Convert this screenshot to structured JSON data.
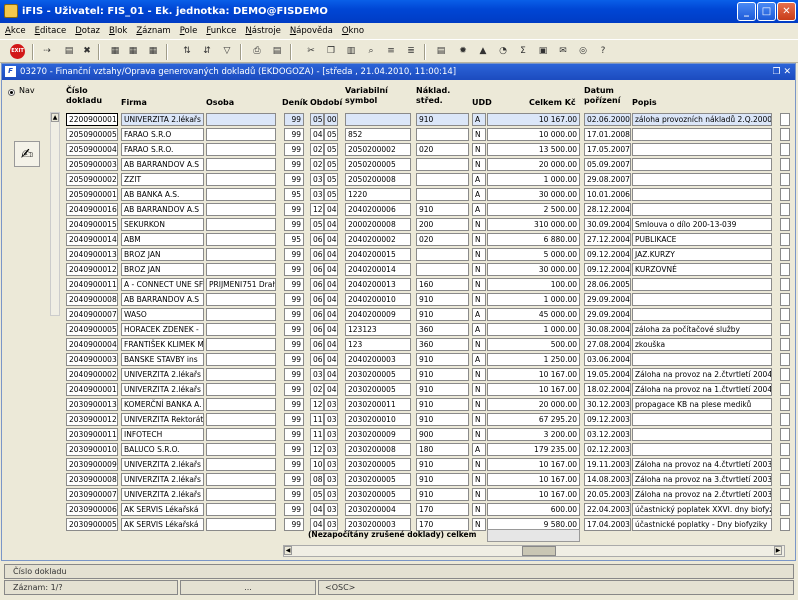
{
  "app": {
    "title": "iFIS - Uživatel: FIS_01 - Ek. jednotka: DEMO@FISDEMO"
  },
  "menu": [
    "Akce",
    "Editace",
    "Dotaz",
    "Blok",
    "Záznam",
    "Pole",
    "Funkce",
    "Nástroje",
    "Nápověda",
    "Okno"
  ],
  "toolbar": {
    "exit_label": "EXIT"
  },
  "window": {
    "title": "03270 - Finanční vztahy/Oprava generovaných dokladů (EKDOGOZA) - [středa , 21.04.2010, 11:00:14]"
  },
  "nav": {
    "label": "Nav"
  },
  "columns": {
    "cislo": "Číslo\ndokladu",
    "firma": "Firma",
    "osoba": "Osoba",
    "denik": "Deník",
    "obdobi": "Období",
    "vs": "Variabilní\nsymbol",
    "ns": "Náklad.\nstřed.",
    "udd": "UDD",
    "celkem": "Celkem Kč",
    "datum": "Datum\npořízení",
    "popis": "Popis"
  },
  "rows": [
    [
      "2200900001",
      "UNIVERZITA 2.lékařs",
      "",
      "99",
      "05",
      "00",
      "",
      "910",
      "A",
      "10 167.00",
      "02.06.2000",
      "záloha provozních nákladů 2.Q.2000"
    ],
    [
      "2050900005",
      "FARAO S.R.O",
      "",
      "99",
      "04",
      "05",
      "852",
      "",
      "N",
      "10 000.00",
      "17.01.2008",
      ""
    ],
    [
      "2050900004",
      "FARAO S.R.O.",
      "",
      "99",
      "02",
      "05",
      "2050200002",
      "020",
      "N",
      "13 500.00",
      "17.05.2007",
      ""
    ],
    [
      "2050900003",
      "AB BARRANDOV A.S",
      "",
      "99",
      "02",
      "05",
      "2050200005",
      "",
      "N",
      "20 000.00",
      "05.09.2007",
      ""
    ],
    [
      "2050900002",
      "ZZIT",
      "",
      "99",
      "03",
      "05",
      "2050200008",
      "",
      "A",
      "1 000.00",
      "29.08.2007",
      ""
    ],
    [
      "2050900001",
      "AB BANKA A.S.",
      "",
      "95",
      "03",
      "05",
      "1220",
      "",
      "A",
      "30 000.00",
      "10.01.2006",
      ""
    ],
    [
      "2040900016",
      "AB BARRANDOV A.S",
      "",
      "99",
      "12",
      "04",
      "2040200006",
      "910",
      "A",
      "2 500.00",
      "28.12.2004",
      ""
    ],
    [
      "2040900015",
      "SEKURKON",
      "",
      "99",
      "05",
      "04",
      "2000200008",
      "200",
      "N",
      "310 000.00",
      "30.09.2004",
      "Smlouva o dílo 200-13-039"
    ],
    [
      "2040900014",
      "ABM",
      "",
      "95",
      "06",
      "04",
      "2040200002",
      "020",
      "N",
      "6 880.00",
      "27.12.2004",
      "PUBLIKACE"
    ],
    [
      "2040900013",
      "BROZ JAN",
      "",
      "99",
      "06",
      "04",
      "2040200015",
      "",
      "N",
      "5 000.00",
      "09.12.2004",
      "JAZ.KURZY"
    ],
    [
      "2040900012",
      "BROZ JAN",
      "",
      "99",
      "06",
      "04",
      "2040200014",
      "",
      "N",
      "30 000.00",
      "09.12.2004",
      "KURZOVNÉ"
    ],
    [
      "2040900011",
      "A - CONNECT UNE SF",
      "PRIJMENI751 Drah",
      "99",
      "06",
      "04",
      "2040200013",
      "160",
      "N",
      "100.00",
      "28.06.2005",
      ""
    ],
    [
      "2040900008",
      "AB BARRANDOV A.S",
      "",
      "99",
      "06",
      "04",
      "2040200010",
      "910",
      "N",
      "1 000.00",
      "29.09.2004",
      ""
    ],
    [
      "2040900007",
      "WASO",
      "",
      "99",
      "06",
      "04",
      "2040200009",
      "910",
      "A",
      "45 000.00",
      "29.09.2004",
      ""
    ],
    [
      "2040900005",
      "HORACEK ZDENEK -",
      "",
      "99",
      "06",
      "04",
      "123123",
      "360",
      "A",
      "1 000.00",
      "30.08.2004",
      "záloha za počítačové služby"
    ],
    [
      "2040900004",
      "FRANTIŠEK KLIMEK M",
      "",
      "99",
      "06",
      "04",
      "123",
      "360",
      "N",
      "500.00",
      "27.08.2004",
      "zkouška"
    ],
    [
      "2040900003",
      "BANSKE STAVBY ins",
      "",
      "99",
      "06",
      "04",
      "2040200003",
      "910",
      "A",
      "1 250.00",
      "03.06.2004",
      ""
    ],
    [
      "2040900002",
      "UNIVERZITA 2.lékařs",
      "",
      "99",
      "03",
      "04",
      "2030200005",
      "910",
      "N",
      "10 167.00",
      "19.05.2004",
      "Záloha na provoz na 2.čtvrtletí 2004"
    ],
    [
      "2040900001",
      "UNIVERZITA 2.lékařs",
      "",
      "99",
      "02",
      "04",
      "2030200005",
      "910",
      "N",
      "10 167.00",
      "18.02.2004",
      "Záloha na provoz na 1.čtvrtletí 2004"
    ],
    [
      "2030900013",
      "KOMERČNÍ BANKA A.",
      "",
      "99",
      "12",
      "03",
      "2030200011",
      "910",
      "N",
      "20 000.00",
      "30.12.2003",
      "propagace KB na plese mediků"
    ],
    [
      "2030900012",
      "UNIVERZITA Rektorát",
      "",
      "99",
      "11",
      "03",
      "2030200010",
      "910",
      "N",
      "67 295.20",
      "09.12.2003",
      ""
    ],
    [
      "2030900011",
      "INFOTECH",
      "",
      "99",
      "11",
      "03",
      "2030200009",
      "900",
      "N",
      "3 200.00",
      "03.12.2003",
      ""
    ],
    [
      "2030900010",
      "BALUCO S.R.O.",
      "",
      "99",
      "12",
      "03",
      "2030200008",
      "180",
      "A",
      "179 235.00",
      "02.12.2003",
      ""
    ],
    [
      "2030900009",
      "UNIVERZITA 2.lékařs",
      "",
      "99",
      "10",
      "03",
      "2030200005",
      "910",
      "N",
      "10 167.00",
      "19.11.2003",
      "Záloha na provoz na 4.čtvrtletí 2003"
    ],
    [
      "2030900008",
      "UNIVERZITA 2.lékařs",
      "",
      "99",
      "08",
      "03",
      "2030200005",
      "910",
      "N",
      "10 167.00",
      "14.08.2003",
      "Záloha na provoz na 3.čtvrtletí 2003"
    ],
    [
      "2030900007",
      "UNIVERZITA 2.lékařs",
      "",
      "99",
      "05",
      "03",
      "2030200005",
      "910",
      "N",
      "10 167.00",
      "20.05.2003",
      "Záloha na provoz na 2.čtvrtletí 2003"
    ],
    [
      "2030900006",
      "AK SERVIS Lékařská",
      "",
      "99",
      "04",
      "03",
      "2030200004",
      "170",
      "N",
      "600.00",
      "22.04.2003",
      "účastnický poplatek XXVI. dny biofyz"
    ],
    [
      "2030900005",
      "AK SERVIS Lékařská",
      "",
      "99",
      "04",
      "03",
      "2030200003",
      "170",
      "N",
      "9 580.00",
      "17.04.2003",
      "účastnické poplatky - Dny biofyziky"
    ]
  ],
  "summary": {
    "label": "(Nezapočítány zrušené doklady) celkem"
  },
  "status": {
    "hint": "Číslo dokladu",
    "record": "Záznam: 1/?",
    "dots": "...",
    "osc": "<OSC>"
  }
}
